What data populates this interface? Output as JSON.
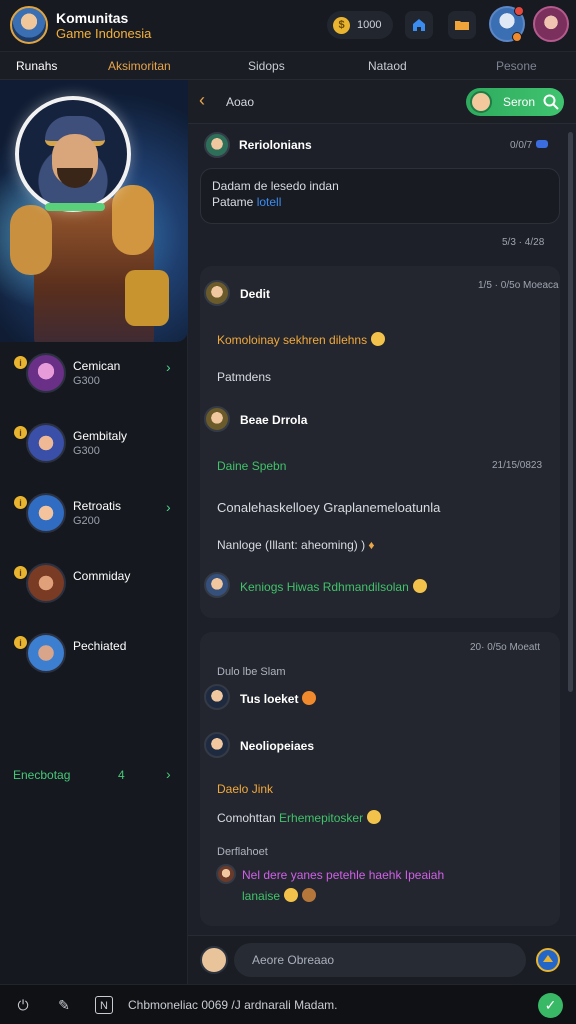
{
  "app": {
    "title": "Komunitas",
    "subtitle": "Game Indonesia"
  },
  "header": {
    "coins": "1000",
    "coin_symbol": "$",
    "notification_count": ""
  },
  "tabs": [
    {
      "label": "Runahs"
    },
    {
      "label": "Aksimoritan"
    },
    {
      "label": "Sidops"
    },
    {
      "label": "Nataod"
    },
    {
      "label": "Pesone"
    }
  ],
  "communities": [
    {
      "name": "Cemican",
      "count": "G300",
      "badge": "i",
      "has_chevron": true
    },
    {
      "name": "Gembitaly",
      "count": "G300",
      "badge": "i",
      "has_chevron": false
    },
    {
      "name": "Retroatis",
      "count": "G200",
      "badge": "i",
      "has_chevron": true
    },
    {
      "name": "Commiday",
      "count": "",
      "badge": "i",
      "has_chevron": false
    },
    {
      "name": "Pechiated",
      "count": "",
      "badge": "i",
      "has_chevron": false
    }
  ],
  "sidebar_footer": {
    "label": "Enecbotag",
    "mark": "4"
  },
  "chat": {
    "title": "Aoao",
    "search_label": "Seron",
    "messages": {
      "m1_name": "Reriolonians",
      "m1_time": "0/0/7",
      "m1_line1": "Dadam de lesedo indan",
      "m1_line2a": "Patame",
      "m1_line2b": "lotell",
      "sep1": "5/3 · 4/28",
      "m2_name": "Dedit",
      "m2_time": "1/5 · 0/5o Moeaca",
      "m2_line1": "Komoloinay sekhren dilehns",
      "m2_line2": "Patmdens",
      "m3_name": "Beae Drrola",
      "m3_sub": "Daine Spebn",
      "m3_time": "21/15/0823",
      "m3_line1": "Conalehaskelloey Graplanemeloatunla",
      "m3_line2": "Nanloge (Illant: aheoming) )",
      "m4_line": "Keniogs Hiwas Rdhmandilsolan",
      "sep2": "20· 0/5o Moeatt",
      "m5_header": "Dulo lbe Slam",
      "m5_line": "Tus loeket",
      "m6_name": "Neoliopeiaes",
      "m6_sub": "Daelo Jink",
      "m6_line_a": "Comohttan",
      "m6_line_b": "Erhemepitosker",
      "m7_header": "Derflahoet",
      "m7_line1": "Nel dere yanes petehle haehk Ipeaiah",
      "m7_line2": "lanaise"
    },
    "composer_placeholder": "Aeore Obreaao"
  },
  "bottom_bar": {
    "text": "Chbmoneliac 0069 /J ardnarali Madam."
  },
  "colors": {
    "accent_green": "#3fc46f",
    "accent_orange": "#e9a54a",
    "accent_gold": "#e9b531",
    "link_blue": "#3b8cf0",
    "text_orange": "#f2a93b",
    "text_green": "#41c26b",
    "text_purple": "#d060e8",
    "text_teal": "#33c3d6"
  },
  "icons": {
    "back": "chevron-left-icon",
    "search": "search-icon",
    "send": "send-icon",
    "home": "home-icon",
    "folder": "folder-icon"
  }
}
